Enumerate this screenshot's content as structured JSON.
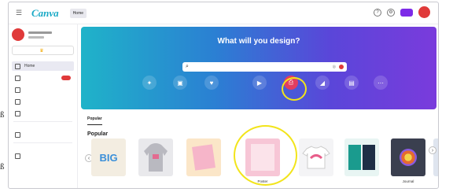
{
  "topbar": {
    "logo": "Canva",
    "nav": [
      {
        "label": "Home",
        "active": true
      },
      {
        "label": "",
        "active": false
      },
      {
        "label": "",
        "active": false
      },
      {
        "label": "",
        "active": false
      },
      {
        "label": "",
        "active": false
      }
    ],
    "create_label": ""
  },
  "sidebar": {
    "account_name": "",
    "try_label": "",
    "items": [
      {
        "label": "Home",
        "active": true,
        "icon": "home-icon",
        "badge": ""
      },
      {
        "label": "",
        "active": false,
        "icon": "folder-icon",
        "badge": ""
      },
      {
        "label": "",
        "active": false,
        "icon": "template-icon",
        "badge": ""
      },
      {
        "label": "",
        "active": false,
        "icon": "brand-icon",
        "badge": ""
      },
      {
        "label": "",
        "active": false,
        "icon": "trash-icon",
        "badge": ""
      }
    ],
    "section_team": "",
    "team_item": "",
    "section_bottom": "",
    "bottom_item": ""
  },
  "hero": {
    "title": "What will you design?",
    "search_placeholder": "",
    "link": "",
    "categories": [
      {
        "label": "",
        "icon": "sparkle-icon",
        "selected": false
      },
      {
        "label": "",
        "icon": "presentation-icon",
        "selected": false
      },
      {
        "label": "",
        "icon": "social-media-icon",
        "selected": false
      },
      {
        "label": "",
        "icon": "video-icon",
        "selected": false
      },
      {
        "label": "",
        "icon": "print-products-icon",
        "selected": true
      },
      {
        "label": "",
        "icon": "marketing-icon",
        "selected": false
      },
      {
        "label": "",
        "icon": "office-icon",
        "selected": false
      },
      {
        "label": "",
        "icon": "more-icon",
        "selected": false
      }
    ]
  },
  "tabs": [
    {
      "label": "Popular",
      "active": true
    },
    {
      "label": "",
      "active": false
    },
    {
      "label": "",
      "active": false
    },
    {
      "label": "",
      "active": false
    },
    {
      "label": "",
      "active": false
    },
    {
      "label": "",
      "active": false
    }
  ],
  "section_title": "Popular",
  "templates": [
    {
      "label": "",
      "card_text": "BIG"
    },
    {
      "label": "",
      "card_text": ""
    },
    {
      "label": "",
      "card_text": ""
    },
    {
      "label": "Poster",
      "card_text": ""
    },
    {
      "label": "",
      "card_text": ""
    },
    {
      "label": "",
      "card_text": ""
    },
    {
      "label": "Journal",
      "card_text": ""
    },
    {
      "label": "",
      "card_text": ""
    }
  ],
  "colors": {
    "brand": "#19a9c6",
    "accent": "#7d2ae8",
    "highlight": "#f2e41a",
    "avatar": "#e03a3a"
  },
  "margin_marks": [
    "ß",
    "ß"
  ]
}
